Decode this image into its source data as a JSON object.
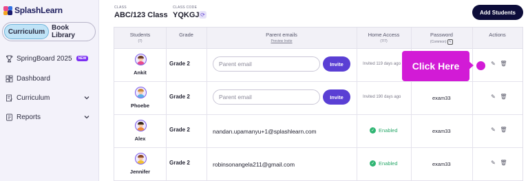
{
  "app": {
    "logo": "SplashLearn"
  },
  "sidebar": {
    "segments": [
      "Curriculum",
      "Book Library"
    ],
    "items": [
      {
        "label": "SpringBoard 2025",
        "badge": "NEW",
        "icon": "trophy-icon"
      },
      {
        "label": "Dashboard",
        "icon": "dashboard-icon"
      },
      {
        "label": "Curriculum",
        "icon": "curriculum-icon",
        "expandable": true
      },
      {
        "label": "Reports",
        "icon": "reports-icon",
        "expandable": true
      }
    ]
  },
  "header": {
    "class_label": "CLASS",
    "class_name": "ABC/123 Class",
    "code_label": "CLASS CODE",
    "class_code": "YQKGJI",
    "add_students": "Add Students"
  },
  "table": {
    "headers": {
      "students": "Students",
      "students_sub": "(7)",
      "grade": "Grade",
      "parent_emails": "Parent emails",
      "parent_emails_sub": "Preview Invite",
      "home_access": "Home Access",
      "home_access_sub": "(7/7)",
      "password": "Password",
      "password_sub": "(Common)",
      "actions": "Actions"
    },
    "rows": [
      {
        "name": "Ankit",
        "grade": "Grade 2",
        "email_placeholder": "Parent email",
        "invite": "Invite",
        "access": "Invited 119 days ago",
        "password": ""
      },
      {
        "name": "Phoebe",
        "grade": "Grade 2",
        "email_placeholder": "Parent email",
        "invite": "Invite",
        "access": "Invited 190 days ago",
        "password": "exam33"
      },
      {
        "name": "Alex",
        "grade": "Grade 2",
        "email": "nandan.upamanyu+1@splashlearn.com",
        "access": "Enabled",
        "password": "exam33"
      },
      {
        "name": "Jennifer",
        "grade": "Grade 2",
        "email": "robinsonangela211@gmail.com",
        "access": "Enabled",
        "password": "exam33"
      }
    ]
  },
  "overlay": {
    "click_here": "Click Here"
  },
  "colors": {
    "brand_dark": "#0d0d3a",
    "accent_purple": "#5a3fd4",
    "highlight_magenta": "#d21bd6",
    "enabled_green": "#2aa86a"
  }
}
